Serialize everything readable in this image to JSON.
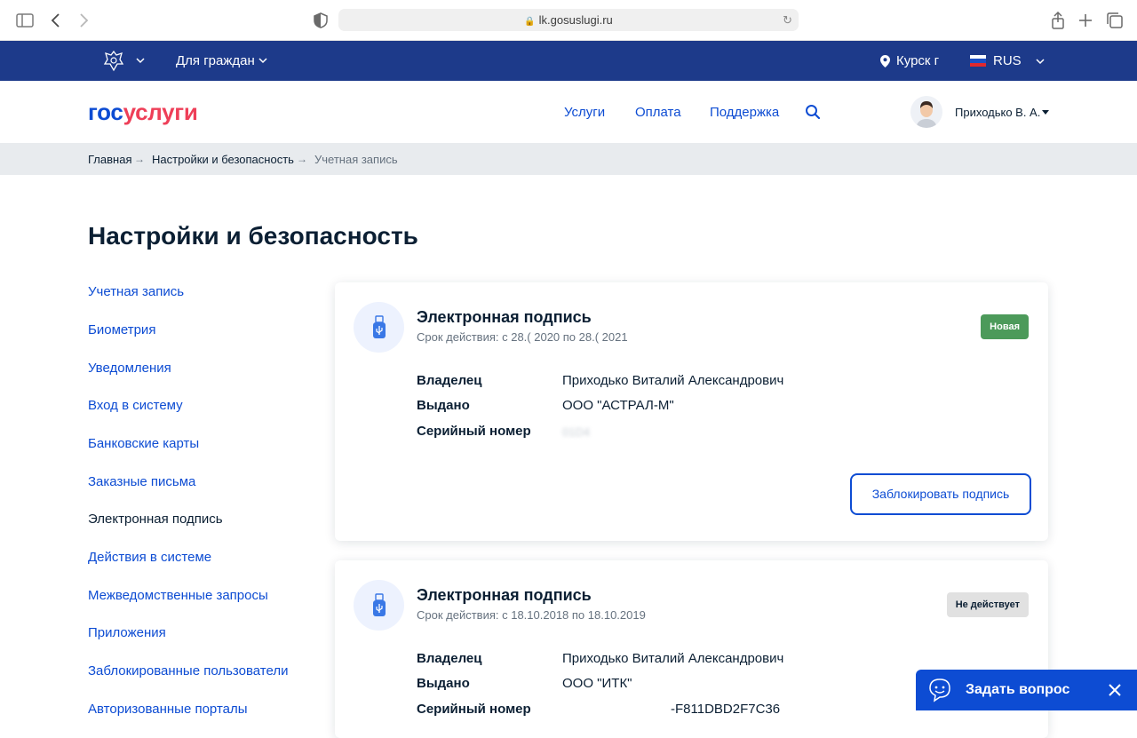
{
  "browser": {
    "url": "lk.gosuslugi.ru"
  },
  "topbar": {
    "for_citizens": "Для граждан",
    "location": "Курск г",
    "language": "RUS",
    "flag_colors": [
      "#ffffff",
      "#1c4fc4",
      "#e0282e"
    ]
  },
  "header": {
    "logo_gos": "гос",
    "logo_uslugi": "услуги",
    "nav": [
      "Услуги",
      "Оплата",
      "Поддержка"
    ],
    "user_name": "Приходько В. А."
  },
  "breadcrumb": [
    "Главная",
    "Настройки и безопасность",
    "Учетная запись"
  ],
  "page_title": "Настройки и безопасность",
  "side_menu": [
    "Учетная запись",
    "Биометрия",
    "Уведомления",
    "Вход в систему",
    "Банковские карты",
    "Заказные письма",
    "Электронная подпись",
    "Действия в системе",
    "Межведомственные запросы",
    "Приложения",
    "Заблокированные пользователи",
    "Авторизованные порталы"
  ],
  "side_menu_active": "Электронная подпись",
  "cards": [
    {
      "title": "Электронная подпись",
      "validity": "Срок действия: с 28.(    2020 по 28.(    2021",
      "badge": "Новая",
      "owner_label": "Владелец",
      "owner": "Приходько Виталий Александрович",
      "issued_label": "Выдано",
      "issuer": "ООО \"АСТРАЛ-М\"",
      "serial_label": "Серийный номер",
      "serial": "01D4",
      "action": "Заблокировать подпись"
    },
    {
      "title": "Электронная подпись",
      "validity": "Срок действия: с 18.10.2018 по 18.10.2019",
      "badge": "Не действует",
      "owner_label": "Владелец",
      "owner": "Приходько Виталий Александрович",
      "issued_label": "Выдано",
      "issuer": "ООО \"ИТК\"",
      "serial_label": "Серийный номер",
      "serial": "-F811DBD2F7C36"
    }
  ],
  "chat": {
    "label": "Задать вопрос"
  },
  "colors": {
    "primary": "#0d4cd3",
    "topbar": "#1d3a8a",
    "logo_red": "#ee3f58",
    "badge_new": "#4c9a5a",
    "badge_inactive": "#e1e1e1"
  }
}
